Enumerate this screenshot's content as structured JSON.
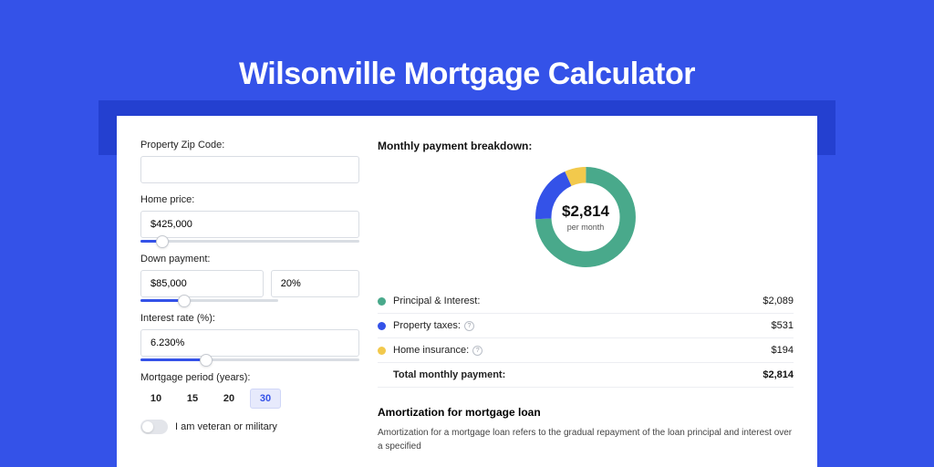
{
  "title": "Wilsonville Mortgage Calculator",
  "form": {
    "zip_label": "Property Zip Code:",
    "zip_value": "",
    "price_label": "Home price:",
    "price_value": "$425,000",
    "down_label": "Down payment:",
    "down_amount": "$85,000",
    "down_percent": "20%",
    "rate_label": "Interest rate (%):",
    "rate_value": "6.230%",
    "period_label": "Mortgage period (years):",
    "periods": [
      "10",
      "15",
      "20",
      "30"
    ],
    "veteran_label": "I am veteran or military"
  },
  "breakdown": {
    "title": "Monthly payment breakdown:",
    "center_amount": "$2,814",
    "center_sub": "per month",
    "items": [
      {
        "label": "Principal & Interest:",
        "value": "$2,089",
        "color": "#49a98b",
        "info": false
      },
      {
        "label": "Property taxes:",
        "value": "$531",
        "color": "#3452e8",
        "info": true
      },
      {
        "label": "Home insurance:",
        "value": "$194",
        "color": "#f2c94c",
        "info": true
      }
    ],
    "total_label": "Total monthly payment:",
    "total_value": "$2,814"
  },
  "amortization": {
    "title": "Amortization for mortgage loan",
    "text": "Amortization for a mortgage loan refers to the gradual repayment of the loan principal and interest over a specified"
  },
  "chart_data": {
    "type": "pie",
    "title": "Monthly payment breakdown",
    "series": [
      {
        "name": "Principal & Interest",
        "value": 2089,
        "color": "#49a98b"
      },
      {
        "name": "Property taxes",
        "value": 531,
        "color": "#3452e8"
      },
      {
        "name": "Home insurance",
        "value": 194,
        "color": "#f2c94c"
      }
    ],
    "total": 2814,
    "unit": "$ per month"
  }
}
